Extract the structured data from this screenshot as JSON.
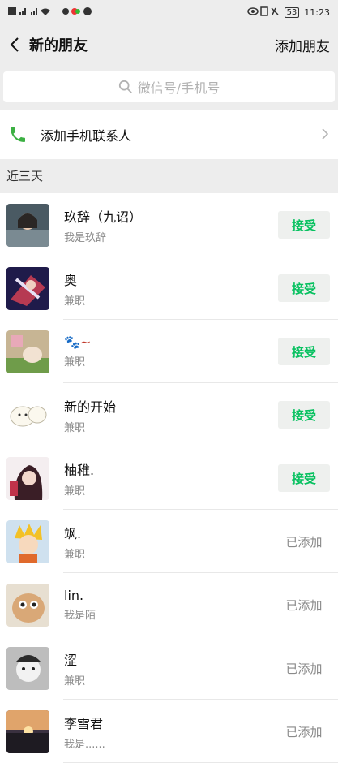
{
  "status": {
    "time": "11:23",
    "battery": "53"
  },
  "nav": {
    "back_icon": "chevron-left-icon",
    "title": "新的朋友",
    "add_label": "添加朋友"
  },
  "search": {
    "placeholder": "微信号/手机号"
  },
  "phone": {
    "label": "添加手机联系人"
  },
  "section": {
    "label": "近三天"
  },
  "requests": [
    {
      "name": "玖辞（九诏）",
      "sub": "我是玖辞",
      "action": "接受",
      "state": "pending"
    },
    {
      "name": "奥",
      "sub": "兼职",
      "action": "接受",
      "state": "pending"
    },
    {
      "name": "🐾~",
      "sub": "兼职",
      "action": "接受",
      "state": "pending"
    },
    {
      "name": "新的开始",
      "sub": "兼职",
      "action": "接受",
      "state": "pending"
    },
    {
      "name": "柚稚.",
      "sub": "兼职",
      "action": "接受",
      "state": "pending"
    },
    {
      "name": "飒.",
      "sub": "兼职",
      "action": "已添加",
      "state": "added"
    },
    {
      "name": "lin.",
      "sub": "我是陌",
      "action": "已添加",
      "state": "added"
    },
    {
      "name": "涩",
      "sub": "兼职",
      "action": "已添加",
      "state": "added"
    },
    {
      "name": "李雪君",
      "sub": "我是......",
      "action": "已添加",
      "state": "added"
    }
  ],
  "colors": {
    "accent": "#07c160",
    "phone_icon": "#3cb043",
    "background": "#ededed"
  }
}
